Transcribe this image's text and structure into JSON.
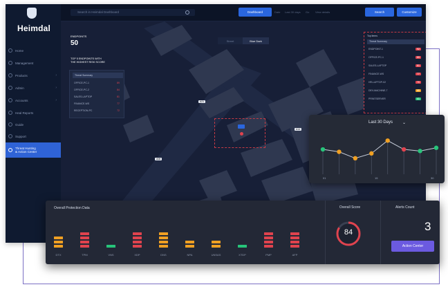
{
  "app": {
    "logo_text": "Heimdal",
    "colors": {
      "accent": "#2a66de",
      "danger": "#e0434e",
      "warning": "#f0a023",
      "ok": "#27c47a",
      "bg": "#0c1426"
    }
  },
  "sidebar": {
    "items": [
      {
        "label": "Home"
      },
      {
        "label": "Management"
      },
      {
        "label": "Products"
      },
      {
        "label": "Admin"
      },
      {
        "label": "Accounts"
      },
      {
        "label": "Heal Reports"
      },
      {
        "label": "Guide"
      },
      {
        "label": "Support"
      }
    ],
    "active_item": {
      "line1": "Threat Hunting",
      "line2": "& Action Center"
    }
  },
  "topbar": {
    "search_placeholder": "Search in Heimdal Dashboard",
    "btn_primary": "Dashboard",
    "text_a": "Date",
    "text_b": "Last 30 days",
    "text_c": "Go",
    "text_d": "View details",
    "btn_right_1": "Search",
    "btn_right_2": "Customize"
  },
  "map": {
    "endpoints_label": "ENDPOINTS",
    "endpoints_value": "50",
    "top_label_line1": "TOP 5 ENDPOINTS WITH",
    "top_label_line2": "THE HIGHEST RISK SCORE",
    "legend_header": "Threat Summary",
    "legend_items": [
      {
        "name": "OFFICE-PC-1",
        "score": "89"
      },
      {
        "name": "OFFICE-PC-2",
        "score": "84"
      },
      {
        "name": "SALES-LAPTOP",
        "score": "81"
      },
      {
        "name": "FINANCE-WS",
        "score": "77"
      },
      {
        "name": "RECEPTION-PC",
        "score": "72"
      }
    ],
    "toggle_left": "Street",
    "toggle_right": "Blue Dark",
    "marker_labels": [
      "A21",
      "A14",
      "A08",
      "A03"
    ],
    "right_panel_header": "Top items",
    "right_panel_sub": "Threat Summary",
    "right_items": [
      {
        "name": "ENDPOINT-1",
        "score": "92"
      },
      {
        "name": "OFFICE-PC-1",
        "score": "89"
      },
      {
        "name": "SALES-LAPTOP",
        "score": "81"
      },
      {
        "name": "FINANCE-WS",
        "score": "77"
      },
      {
        "name": "HR-LAPTOP-02",
        "score": "70"
      },
      {
        "name": "DEV-MACHINE-7",
        "score": "65"
      },
      {
        "name": "PRINTSERVER",
        "score": "41"
      }
    ]
  },
  "trend": {
    "title": "Last 30 Days",
    "x_labels": [
      "01",
      "15",
      "30"
    ],
    "points": [
      {
        "value": 0.62,
        "status": "ok"
      },
      {
        "value": 0.56,
        "status": "warning"
      },
      {
        "value": 0.4,
        "status": "warning"
      },
      {
        "value": 0.52,
        "status": "warning"
      },
      {
        "value": 0.84,
        "status": "warning"
      },
      {
        "value": 0.62,
        "status": "danger"
      },
      {
        "value": 0.58,
        "status": "ok"
      },
      {
        "value": 0.66,
        "status": "ok"
      }
    ]
  },
  "bottom": {
    "title": "Overall Protection Data",
    "bars": [
      {
        "label": "DTX",
        "status": "warning",
        "level": 3
      },
      {
        "label": "TPM",
        "status": "danger",
        "level": 4
      },
      {
        "label": "VNS",
        "status": "ok",
        "level": 1
      },
      {
        "label": "XDP",
        "status": "danger",
        "level": 4
      },
      {
        "label": "DNS",
        "status": "warning",
        "level": 4
      },
      {
        "label": "NPA",
        "status": "warning",
        "level": 2
      },
      {
        "label": "UNSAS",
        "status": "warning",
        "level": 2
      },
      {
        "label": "XTDP",
        "status": "ok",
        "level": 1
      },
      {
        "label": "PMP",
        "status": "danger",
        "level": 4
      },
      {
        "label": "AFP",
        "status": "danger",
        "level": 4
      }
    ],
    "score_label": "Overall Score",
    "score_value": "84",
    "score_fraction": 0.84,
    "alerts_label": "Alerts Count",
    "alerts_value": "3",
    "action_button": "Action Center"
  }
}
